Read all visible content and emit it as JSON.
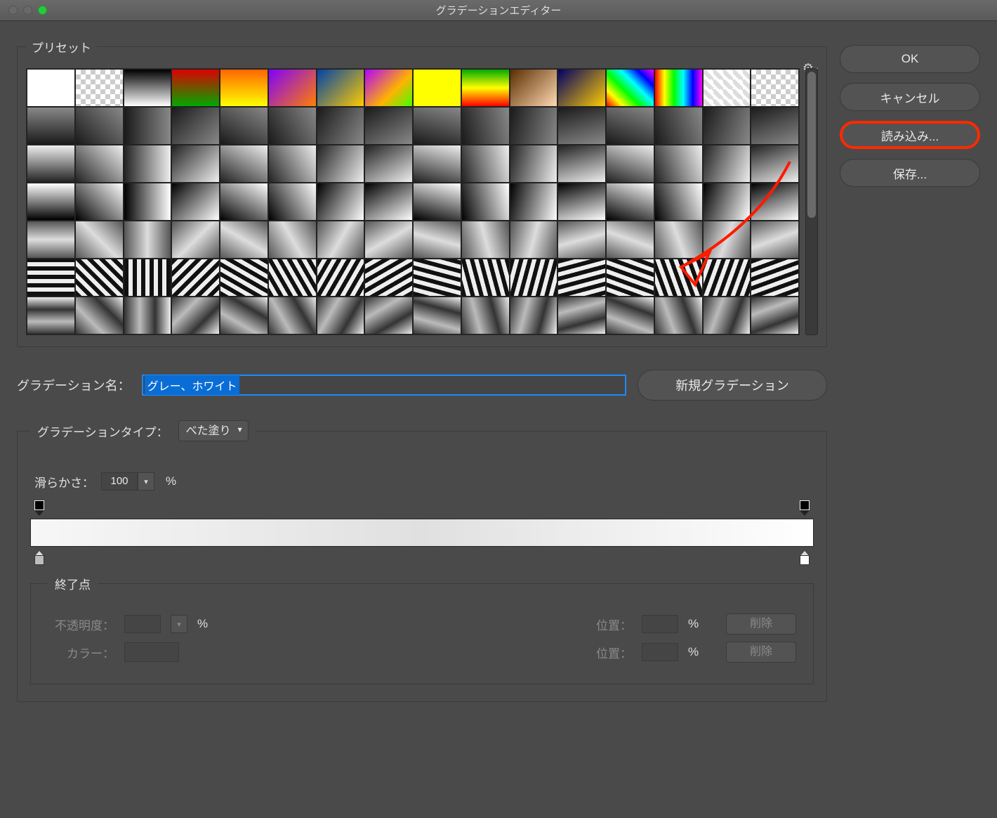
{
  "window": {
    "title": "グラデーションエディター"
  },
  "preset": {
    "legend": "プリセット",
    "gear_icon": "gear-icon"
  },
  "buttons": {
    "ok": "OK",
    "cancel": "キャンセル",
    "load": "読み込み...",
    "save": "保存...",
    "new_gradient": "新規グラデーション"
  },
  "name": {
    "label": "グラデーション名：",
    "value": "グレー、ホワイト"
  },
  "type": {
    "legend": "グラデーションタイプ：",
    "selected": "べた塗り",
    "smoothness_label": "滑らかさ：",
    "smoothness_value": "100",
    "percent": "%"
  },
  "stops": {
    "legend": "終了点",
    "opacity_label": "不透明度：",
    "opacity_value": "",
    "color_label": "カラー：",
    "position_label": "位置：",
    "position_value": "",
    "delete_label": "削除",
    "percent": "%"
  },
  "annotation": {
    "arrow": "highlight-arrow"
  },
  "preset_swatches": [
    "linear-gradient(#fff,#fff)",
    "checker",
    "linear-gradient(#000,#fff)",
    "linear-gradient(#d00,#0a0)",
    "linear-gradient(#f60,#ff0)",
    "linear-gradient(135deg,#8000ff,#ff8000)",
    "linear-gradient(135deg,#0042a8,#ffcb00)",
    "linear-gradient(135deg,#b300ff,#ffb300 60%,#43ff00)",
    "linear-gradient(#ff0,#ff0)",
    "linear-gradient(#0a0,#ff0,#f00)",
    "linear-gradient(135deg,#5a2e00,#ffd9b3)",
    "linear-gradient(135deg,#006,#fc0)",
    "linear-gradient(45deg,#f00,#ff0,#0f0,#0ff,#00f,#f0f)",
    "linear-gradient(90deg,#f00,#ff0,#0f0,#0ff,#00f,#f0f)",
    "checker-diag",
    "checker"
  ]
}
